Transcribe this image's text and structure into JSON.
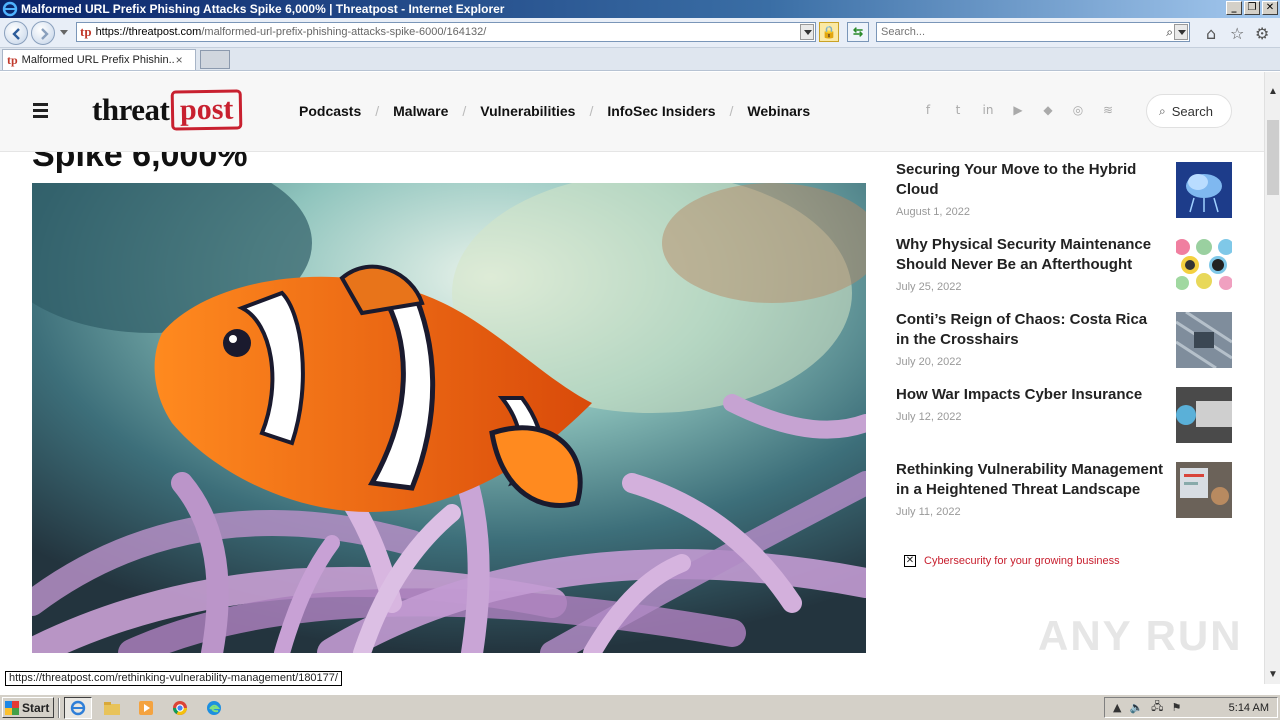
{
  "window": {
    "title": "Malformed URL Prefix Phishing Attacks Spike 6,000% | Threatpost - Internet Explorer",
    "controls": [
      "_",
      "❐",
      "✕"
    ]
  },
  "addressbar": {
    "favicon": "tp",
    "url_domain": "https://threatpost.com",
    "url_path": "/malformed-url-prefix-phishing-attacks-spike-6000/164132/",
    "search_placeholder": "Search..."
  },
  "tabs": [
    {
      "favicon": "tp",
      "title": "Malformed URL Prefix Phishin...",
      "close": "×"
    }
  ],
  "site": {
    "logo_threat": "threat",
    "logo_post": "post",
    "nav": [
      "Podcasts",
      "Malware",
      "Vulnerabilities",
      "InfoSec Insiders",
      "Webinars"
    ],
    "nav_separator": "/",
    "social_icons": [
      "facebook-icon",
      "twitter-icon",
      "linkedin-icon",
      "youtube-icon",
      "feedly-icon",
      "instagram-icon",
      "rss-icon"
    ],
    "social_glyphs": [
      "f",
      "t",
      "in",
      "▶",
      "◆",
      "◎",
      "≋"
    ],
    "search_label": "Search"
  },
  "article": {
    "title_fragment": "Spike 6,000%"
  },
  "sidebar": [
    {
      "title": "Securing Your Move to the Hybrid Cloud",
      "date": "August 1, 2022"
    },
    {
      "title": "Why Physical Security Maintenance Should Never Be an Afterthought",
      "date": "July 25, 2022"
    },
    {
      "title": "Conti’s Reign of Chaos: Costa Rica in the Crosshairs",
      "date": "July 20, 2022"
    },
    {
      "title": "How War Impacts Cyber Insurance",
      "date": "July 12, 2022"
    },
    {
      "title": "Rethinking Vulnerability Management in a Heightened Threat Landscape",
      "date": "July 11, 2022"
    }
  ],
  "ad": {
    "close": "✕",
    "text": "Cybersecurity for your growing business"
  },
  "watermark": "ANY RUN",
  "status_url": "https://threatpost.com/rethinking-vulnerability-management/180177/",
  "taskbar": {
    "start_label": "Start",
    "clock": "5:14 AM"
  },
  "colors": {
    "brand_red": "#c8202f",
    "titlebar_blue": "#0a246a"
  }
}
